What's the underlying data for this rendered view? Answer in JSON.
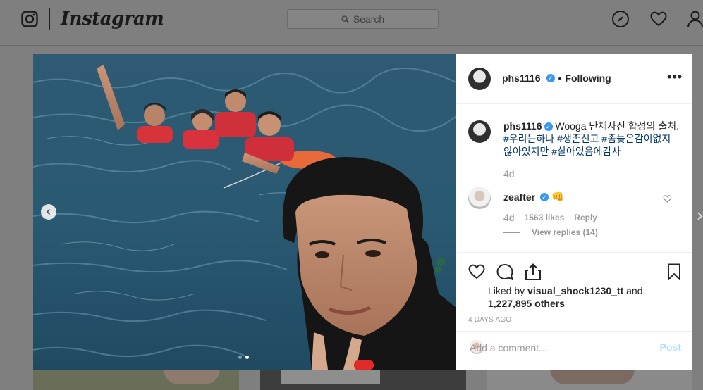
{
  "nav": {
    "wordmark": "Instagram",
    "search_placeholder": "Search",
    "icons": [
      "instagram-logo-icon",
      "compass-icon",
      "heart-icon",
      "profile-icon"
    ]
  },
  "post": {
    "author": {
      "username": "phs1116",
      "verified": true,
      "follow_status": "Following",
      "follow_separator": "•"
    },
    "more_options_icon": "more-options-icon",
    "caption": {
      "username": "phs1116",
      "text_plain": "Wooga 단체사진 합성의 출처. ",
      "hashtags": [
        "#우리는하나",
        "#생존신고",
        "#좀늦은감이없지않아있지만",
        "#살아있음에감사"
      ],
      "hashtag_joiner": " ",
      "age": "4d"
    },
    "comments": [
      {
        "username": "zeafter",
        "verified": true,
        "text": "👊",
        "age": "4d",
        "likes": "1563 likes",
        "reply_label": "Reply",
        "view_replies": "View replies (14)"
      }
    ],
    "likes": {
      "prefix": "Liked by",
      "user": "visual_shock1230_tt",
      "joiner": "and",
      "others": "1,227,895 others"
    },
    "timestamp": "4 DAYS AGO",
    "add_comment_placeholder": "Add a comment...",
    "post_button": "Post",
    "carousel": {
      "current": 2,
      "total": 2
    }
  },
  "colors": {
    "overlay": "#7f7f7f",
    "verified": "#3897f0",
    "hashtag": "#003569",
    "muted": "#999999",
    "post_button_disabled": "#b2dffc"
  }
}
